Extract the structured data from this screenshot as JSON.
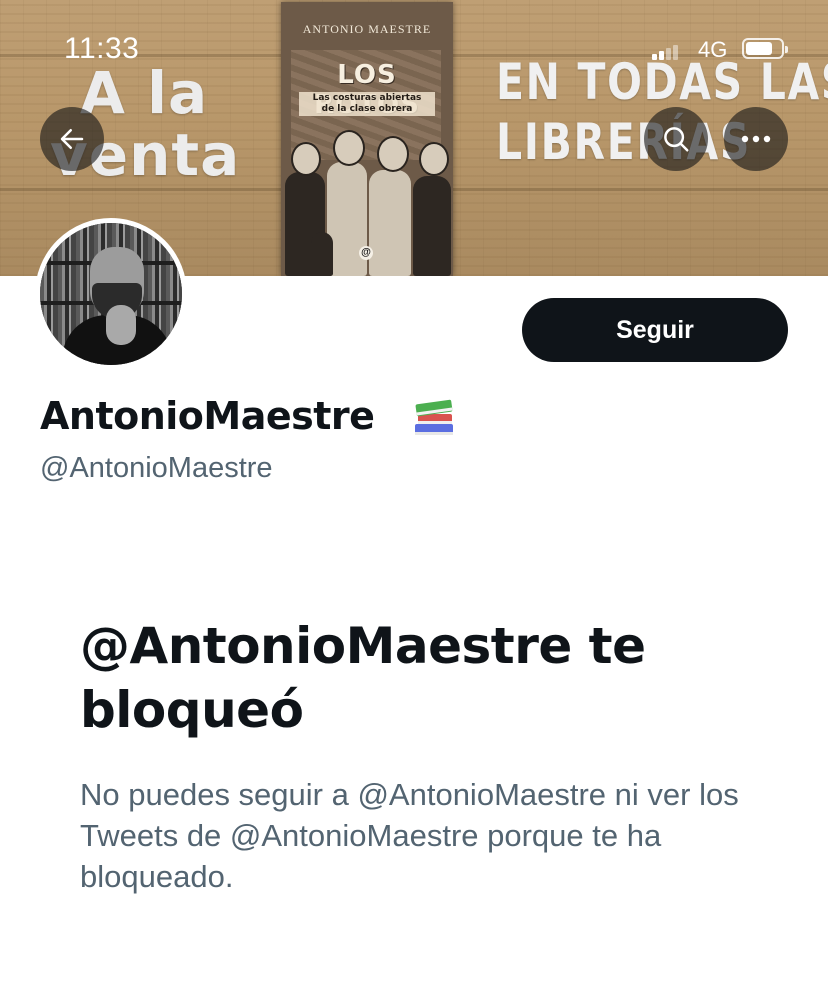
{
  "status_bar": {
    "time": "11:33",
    "network": "4G",
    "battery_level": 0.75
  },
  "banner": {
    "left_text": [
      "A la",
      "venta"
    ],
    "right_text": [
      "EN TODAS LAS",
      "LIBRERÍAS"
    ],
    "book": {
      "author": "ANTONIO MAESTRE",
      "title": "LOS ROTOS",
      "subtitle_lines": [
        "Las costuras abiertas",
        "de la clase obrera"
      ],
      "publisher_mark": "@"
    }
  },
  "header_buttons": {
    "back": "back-arrow-icon",
    "search": "search-icon",
    "more": "more-options-icon"
  },
  "profile": {
    "display_name": "AntonioMaestre",
    "name_emoji": "books-icon",
    "handle": "@AntonioMaestre",
    "follow_label": "Seguir"
  },
  "blocked": {
    "title": "@AntonioMaestre te bloqueó",
    "description": "No puedes seguir a @AntonioMaestre ni ver los Tweets de @AntonioMaestre porque te ha bloqueado."
  },
  "colors": {
    "primary_text": "#0f1419",
    "secondary_text": "#536471",
    "button_bg": "#0f1419",
    "button_text": "#ffffff",
    "background": "#ffffff"
  }
}
